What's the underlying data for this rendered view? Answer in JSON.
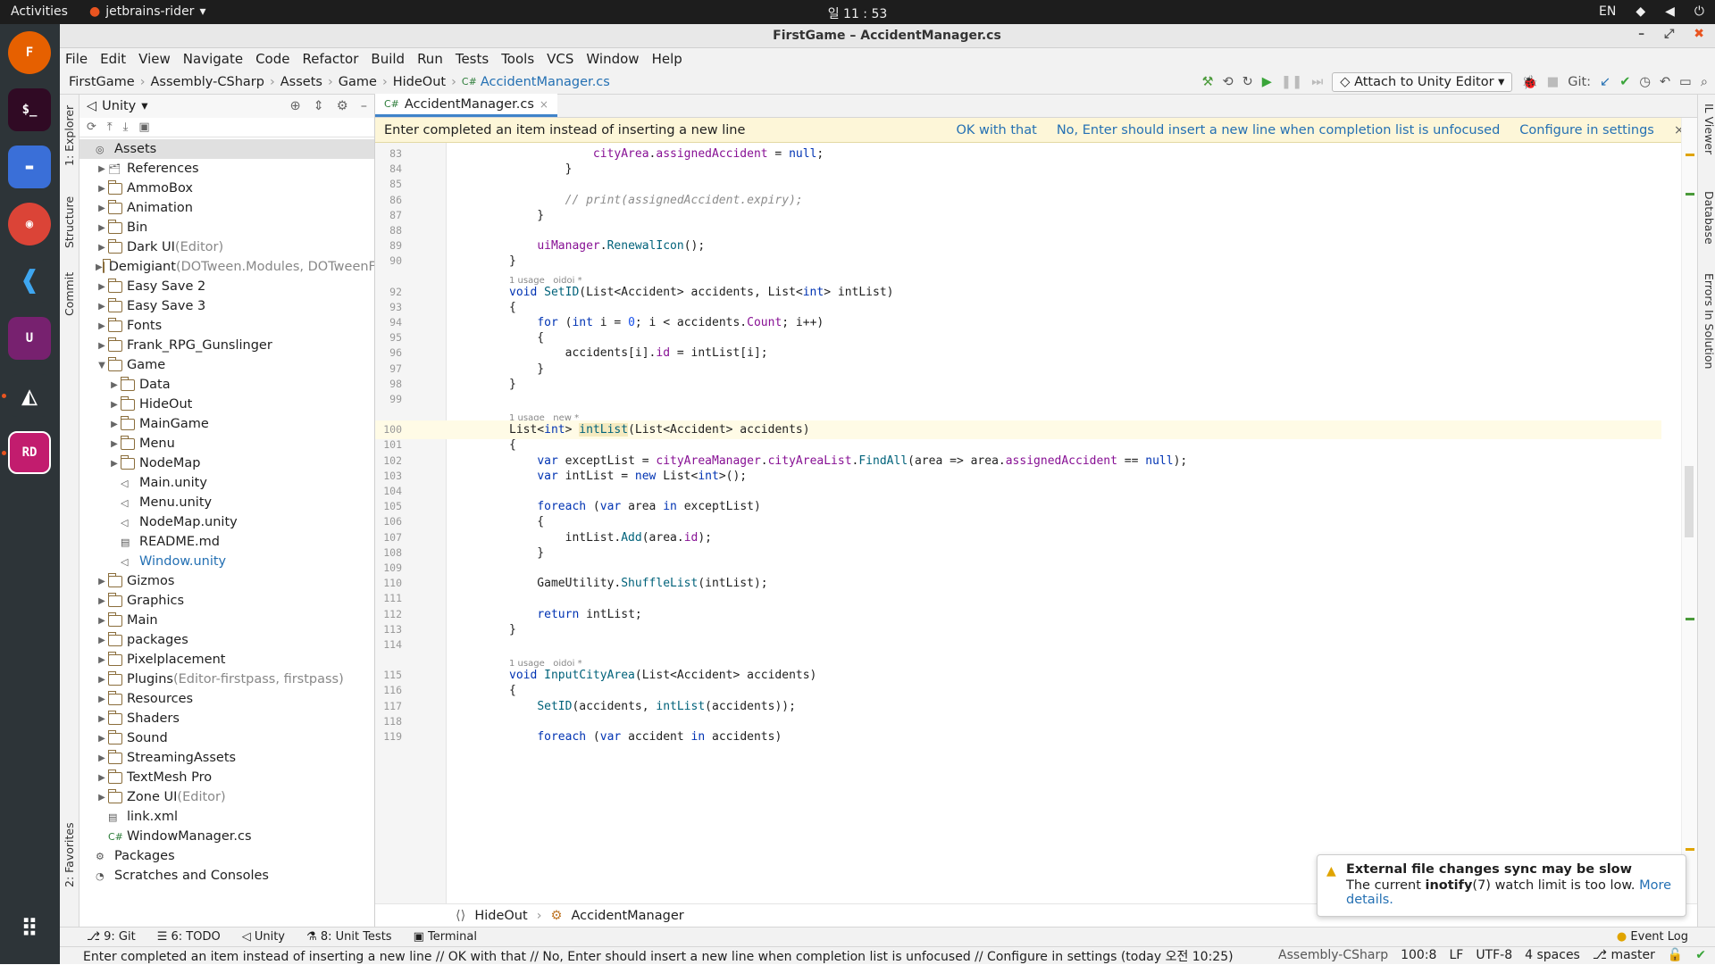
{
  "system_bar": {
    "activities": "Activities",
    "app": "jetbrains-rider",
    "clock": "일 11 : 53",
    "lang": "EN"
  },
  "window": {
    "title": "FirstGame – AccidentManager.cs"
  },
  "menu": [
    "File",
    "Edit",
    "View",
    "Navigate",
    "Code",
    "Refactor",
    "Build",
    "Run",
    "Tests",
    "Tools",
    "VCS",
    "Window",
    "Help"
  ],
  "breadcrumbs": [
    "FirstGame",
    "Assembly-CSharp",
    "Assets",
    "Game",
    "HideOut",
    "AccidentManager.cs"
  ],
  "toolbar": {
    "attach": "Attach to Unity Editor",
    "git": "Git:"
  },
  "left_tool_tabs": [
    "1: Explorer",
    "Structure",
    "Commit",
    "2: Favorites"
  ],
  "explorer": {
    "header": "Unity",
    "items": [
      {
        "label": "Assets",
        "suffix": "",
        "depth": 0,
        "arrow": "",
        "kind": "assets",
        "sel": true
      },
      {
        "label": "References",
        "suffix": "",
        "depth": 1,
        "arrow": "▶",
        "kind": "ref"
      },
      {
        "label": "AmmoBox",
        "suffix": "",
        "depth": 1,
        "arrow": "▶",
        "kind": "folder"
      },
      {
        "label": "Animation",
        "suffix": "",
        "depth": 1,
        "arrow": "▶",
        "kind": "folder"
      },
      {
        "label": "Bin",
        "suffix": "",
        "depth": 1,
        "arrow": "▶",
        "kind": "folder"
      },
      {
        "label": "Dark UI",
        "suffix": " (Editor)",
        "depth": 1,
        "arrow": "▶",
        "kind": "folder"
      },
      {
        "label": "Demigiant",
        "suffix": " (DOTween.Modules, DOTweenF",
        "depth": 1,
        "arrow": "▶",
        "kind": "folder"
      },
      {
        "label": "Easy Save 2",
        "suffix": "",
        "depth": 1,
        "arrow": "▶",
        "kind": "folder"
      },
      {
        "label": "Easy Save 3",
        "suffix": "",
        "depth": 1,
        "arrow": "▶",
        "kind": "folder"
      },
      {
        "label": "Fonts",
        "suffix": "",
        "depth": 1,
        "arrow": "▶",
        "kind": "folder"
      },
      {
        "label": "Frank_RPG_Gunslinger",
        "suffix": "",
        "depth": 1,
        "arrow": "▶",
        "kind": "folder"
      },
      {
        "label": "Game",
        "suffix": "",
        "depth": 1,
        "arrow": "▼",
        "kind": "folder"
      },
      {
        "label": "Data",
        "suffix": "",
        "depth": 2,
        "arrow": "▶",
        "kind": "folder"
      },
      {
        "label": "HideOut",
        "suffix": "",
        "depth": 2,
        "arrow": "▶",
        "kind": "folder"
      },
      {
        "label": "MainGame",
        "suffix": "",
        "depth": 2,
        "arrow": "▶",
        "kind": "folder"
      },
      {
        "label": "Menu",
        "suffix": "",
        "depth": 2,
        "arrow": "▶",
        "kind": "folder"
      },
      {
        "label": "NodeMap",
        "suffix": "",
        "depth": 2,
        "arrow": "▶",
        "kind": "folder"
      },
      {
        "label": "Main.unity",
        "suffix": "",
        "depth": 2,
        "arrow": "",
        "kind": "unity"
      },
      {
        "label": "Menu.unity",
        "suffix": "",
        "depth": 2,
        "arrow": "",
        "kind": "unity"
      },
      {
        "label": "NodeMap.unity",
        "suffix": "",
        "depth": 2,
        "arrow": "",
        "kind": "unity"
      },
      {
        "label": "README.md",
        "suffix": "",
        "depth": 2,
        "arrow": "",
        "kind": "md"
      },
      {
        "label": "Window.unity",
        "suffix": "",
        "depth": 2,
        "arrow": "",
        "kind": "unity",
        "blue": true
      },
      {
        "label": "Gizmos",
        "suffix": "",
        "depth": 1,
        "arrow": "▶",
        "kind": "folder"
      },
      {
        "label": "Graphics",
        "suffix": "",
        "depth": 1,
        "arrow": "▶",
        "kind": "folder"
      },
      {
        "label": "Main",
        "suffix": "",
        "depth": 1,
        "arrow": "▶",
        "kind": "folder"
      },
      {
        "label": "packages",
        "suffix": "",
        "depth": 1,
        "arrow": "▶",
        "kind": "folder"
      },
      {
        "label": "Pixelplacement",
        "suffix": "",
        "depth": 1,
        "arrow": "▶",
        "kind": "folder"
      },
      {
        "label": "Plugins",
        "suffix": " (Editor-firstpass, firstpass)",
        "depth": 1,
        "arrow": "▶",
        "kind": "folder"
      },
      {
        "label": "Resources",
        "suffix": "",
        "depth": 1,
        "arrow": "▶",
        "kind": "folder"
      },
      {
        "label": "Shaders",
        "suffix": "",
        "depth": 1,
        "arrow": "▶",
        "kind": "folder"
      },
      {
        "label": "Sound",
        "suffix": "",
        "depth": 1,
        "arrow": "▶",
        "kind": "folder"
      },
      {
        "label": "StreamingAssets",
        "suffix": "",
        "depth": 1,
        "arrow": "▶",
        "kind": "folder"
      },
      {
        "label": "TextMesh Pro",
        "suffix": "",
        "depth": 1,
        "arrow": "▶",
        "kind": "folder"
      },
      {
        "label": "Zone UI",
        "suffix": " (Editor)",
        "depth": 1,
        "arrow": "▶",
        "kind": "folder"
      },
      {
        "label": "link.xml",
        "suffix": "",
        "depth": 1,
        "arrow": "",
        "kind": "xml"
      },
      {
        "label": "WindowManager.cs",
        "suffix": "",
        "depth": 1,
        "arrow": "",
        "kind": "cs"
      },
      {
        "label": "Packages",
        "suffix": "",
        "depth": 0,
        "arrow": "",
        "kind": "pkg"
      },
      {
        "label": "Scratches and Consoles",
        "suffix": "",
        "depth": 0,
        "arrow": "",
        "kind": "scratch"
      }
    ]
  },
  "editor": {
    "tab": "AccidentManager.cs",
    "notice": {
      "text": "Enter completed an item instead of inserting a new line",
      "ok": "OK with that",
      "no": "No, Enter should insert a new line when completion list is unfocused",
      "cfg": "Configure in settings"
    },
    "lines": [
      {
        "n": "83",
        "h": "            <span class=\"fd\">cityArea</span>.<span class=\"fd\">assignedAccident</span> = <span class=\"kw\">null</span>;"
      },
      {
        "n": "84",
        "h": "        }"
      },
      {
        "n": "85",
        "h": ""
      },
      {
        "n": "86",
        "h": "        <span class=\"cm\">// print(assignedAccident.expiry);</span>"
      },
      {
        "n": "87",
        "h": "    }"
      },
      {
        "n": "88",
        "h": ""
      },
      {
        "n": "89",
        "h": "    <span class=\"fd\">uiManager</span>.<span class=\"mt\">RenewalIcon</span>();"
      },
      {
        "n": "90",
        "h": "}"
      },
      {
        "n": "",
        "hint": "1 usage   oidoi *"
      },
      {
        "n": "92",
        "h": "<span class=\"kw\">void</span> <span class=\"fn\">SetID</span>(List&lt;Accident&gt; accidents, List&lt;<span class=\"kw\">int</span>&gt; intList)"
      },
      {
        "n": "93",
        "h": "{"
      },
      {
        "n": "94",
        "h": "    <span class=\"kw\">for</span> (<span class=\"kw\">int</span> i = <span class=\"nm\">0</span>; i &lt; accidents.<span class=\"fd\">Count</span>; i++)"
      },
      {
        "n": "95",
        "h": "    {"
      },
      {
        "n": "96",
        "h": "        accidents[i].<span class=\"fd\">id</span> = intList[i];"
      },
      {
        "n": "97",
        "h": "    }"
      },
      {
        "n": "98",
        "h": "}"
      },
      {
        "n": "99",
        "h": ""
      },
      {
        "n": "",
        "hint": "1 usage   new *"
      },
      {
        "n": "100",
        "h": "List&lt;<span class=\"kw\">int</span>&gt; <span class=\"fn\" style=\"background:#f5eabf\">intList</span>(List&lt;Accident&gt; accidents)",
        "cur": true
      },
      {
        "n": "101",
        "h": "{"
      },
      {
        "n": "102",
        "h": "    <span class=\"kw\">var</span> exceptList = <span class=\"fd\">cityAreaManager</span>.<span class=\"fd\">cityAreaList</span>.<span class=\"mt\">FindAll</span>(area =&gt; area.<span class=\"fd\">assignedAccident</span> == <span class=\"kw\">null</span>);"
      },
      {
        "n": "103",
        "h": "    <span class=\"kw\">var</span> intList = <span class=\"kw\">new</span> List&lt;<span class=\"kw\">int</span>&gt;();"
      },
      {
        "n": "104",
        "h": ""
      },
      {
        "n": "105",
        "h": "    <span class=\"kw\">foreach</span> (<span class=\"kw\">var</span> area <span class=\"kw\">in</span> exceptList)"
      },
      {
        "n": "106",
        "h": "    {"
      },
      {
        "n": "107",
        "h": "        intList.<span class=\"mt\">Add</span>(area.<span class=\"fd\">id</span>);"
      },
      {
        "n": "108",
        "h": "    }"
      },
      {
        "n": "109",
        "h": ""
      },
      {
        "n": "110",
        "h": "    GameUtility.<span class=\"mt\">ShuffleList</span>(intList);"
      },
      {
        "n": "111",
        "h": ""
      },
      {
        "n": "112",
        "h": "    <span class=\"kw\">return</span> intList;"
      },
      {
        "n": "113",
        "h": "}"
      },
      {
        "n": "114",
        "h": ""
      },
      {
        "n": "",
        "hint": "1 usage   oidoi *"
      },
      {
        "n": "115",
        "h": "<span class=\"kw\">void</span> <span class=\"fn\">InputCityArea</span>(List&lt;Accident&gt; accidents)"
      },
      {
        "n": "116",
        "h": "{"
      },
      {
        "n": "117",
        "h": "    <span class=\"mt\">SetID</span>(accidents, <span class=\"mt\">intList</span>(accidents));"
      },
      {
        "n": "118",
        "h": ""
      },
      {
        "n": "119",
        "h": "    <span class=\"kw\">foreach</span> (<span class=\"kw\">var</span> accident <span class=\"kw\">in</span> accidents)"
      }
    ],
    "breadcrumb": [
      "HideOut",
      "AccidentManager"
    ]
  },
  "right_tool_tabs": [
    "IL Viewer",
    "Database",
    "Errors In Solution"
  ],
  "balloon": {
    "title": "External file changes sync may be slow",
    "body_pre": "The current ",
    "body_bold": "inotify",
    "body_post": "(7) watch limit is too low. ",
    "link1": "More",
    "link2": "details."
  },
  "tool_windows": [
    "9: Git",
    "6: TODO",
    "Unity",
    "8: Unit Tests",
    "Terminal"
  ],
  "event_log": "Event Log",
  "status": {
    "text": "Enter completed an item instead of inserting a new line // OK with that // No, Enter should insert a new line when completion list is unfocused // Configure in settings (today 오전 10:25)",
    "project": "Assembly-CSharp",
    "pos": "100:8",
    "eol": "LF",
    "enc": "UTF-8",
    "indent": "4 spaces",
    "branch": "master"
  }
}
